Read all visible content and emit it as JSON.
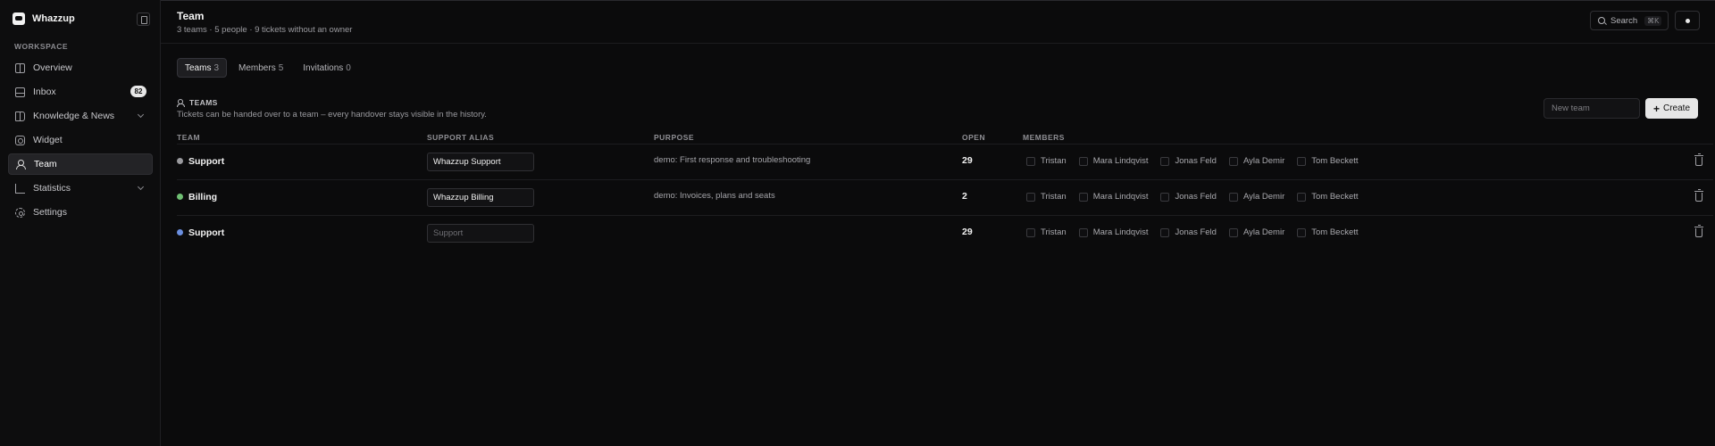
{
  "app": {
    "name": "Whazzup"
  },
  "sidebar": {
    "section_label": "WORKSPACE",
    "items": [
      {
        "label": "Overview",
        "icon": "grid-icon"
      },
      {
        "label": "Inbox",
        "icon": "inbox-icon",
        "badge": "82"
      },
      {
        "label": "Knowledge & News",
        "icon": "book-icon",
        "expandable": true
      },
      {
        "label": "Widget",
        "icon": "widget-icon"
      },
      {
        "label": "Team",
        "icon": "users-icon",
        "active": true
      },
      {
        "label": "Statistics",
        "icon": "chart-icon",
        "expandable": true
      },
      {
        "label": "Settings",
        "icon": "gear-icon"
      }
    ]
  },
  "header": {
    "title": "Team",
    "subtitle": "3 teams · 5 people · 9 tickets without an owner",
    "search_label": "Search",
    "search_shortcut": "⌘K"
  },
  "tabs": [
    {
      "label": "Teams",
      "count": "3",
      "active": true
    },
    {
      "label": "Members",
      "count": "5"
    },
    {
      "label": "Invitations",
      "count": "0"
    }
  ],
  "teams_section": {
    "heading": "TEAMS",
    "description": "Tickets can be handed over to a team – every handover stays visible in the history.",
    "new_team_placeholder": "New team",
    "create_label": "Create"
  },
  "table": {
    "headers": [
      "TEAM",
      "SUPPORT ALIAS",
      "PURPOSE",
      "OPEN",
      "MEMBERS"
    ],
    "rows": [
      {
        "name": "Support",
        "dot_color": "#9a9a9e",
        "alias": "Whazzup Support",
        "alias_placeholder": "",
        "purpose": "demo: First response and troubleshooting",
        "open": "29",
        "members": [
          "Tristan",
          "Mara Lindqvist",
          "Jonas Feld",
          "Ayla Demir",
          "Tom Beckett"
        ]
      },
      {
        "name": "Billing",
        "dot_color": "#6fbf73",
        "alias": "Whazzup Billing",
        "alias_placeholder": "",
        "purpose": "demo: Invoices, plans and seats",
        "open": "2",
        "members": [
          "Tristan",
          "Mara Lindqvist",
          "Jonas Feld",
          "Ayla Demir",
          "Tom Beckett"
        ]
      },
      {
        "name": "Support",
        "dot_color": "#6b8fe0",
        "alias": "",
        "alias_placeholder": "Support",
        "purpose": "",
        "open": "29",
        "members": [
          "Tristan",
          "Mara Lindqvist",
          "Jonas Feld",
          "Ayla Demir",
          "Tom Beckett"
        ]
      }
    ]
  }
}
